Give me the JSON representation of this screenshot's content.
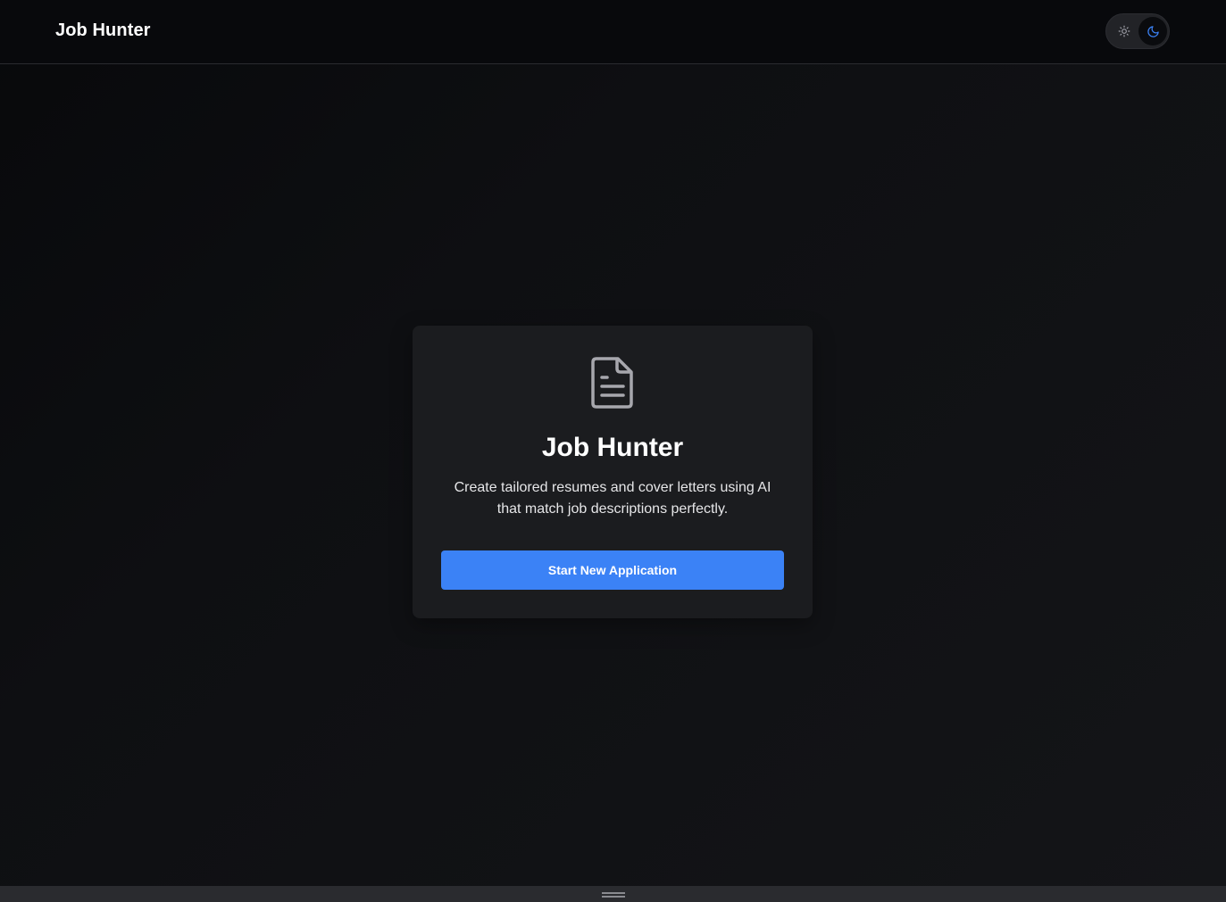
{
  "header": {
    "brand": "Job Hunter",
    "theme_toggle": {
      "options": [
        {
          "icon": "sun-icon",
          "selected": false
        },
        {
          "icon": "moon-icon",
          "selected": true
        }
      ]
    }
  },
  "hero": {
    "icon": "document-icon",
    "title": "Job Hunter",
    "description": "Create tailored resumes and cover letters using AI that match job descriptions perfectly.",
    "cta_label": "Start New Application"
  },
  "colors": {
    "accent": "#3b82f6",
    "background": "#0f0f11",
    "card": "#1b1c1f"
  }
}
